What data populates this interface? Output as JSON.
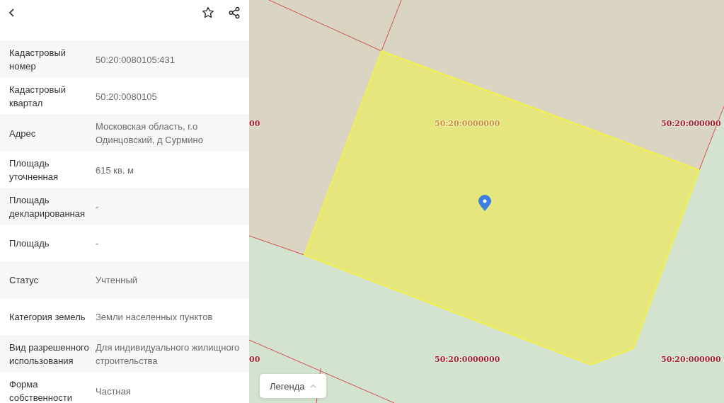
{
  "properties": [
    {
      "label": "Кадастровый номер",
      "value": "50:20:0080105:431"
    },
    {
      "label": "Кадастровый квартал",
      "value": "50:20:0080105"
    },
    {
      "label": "Адрес",
      "value": "Московская область, г.о Одинцовский, д Сурмино"
    },
    {
      "label": "Площадь уточненная",
      "value": "615 кв. м"
    },
    {
      "label": "Площадь декларированная",
      "value": "-"
    },
    {
      "label": "Площадь",
      "value": "-"
    },
    {
      "label": "Статус",
      "value": "Учтенный"
    },
    {
      "label": "Категория земель",
      "value": "Земли населенных пунктов"
    },
    {
      "label": "Вид разрешенного использования",
      "value": "Для индивидуального жилищного строительства"
    },
    {
      "label": "Форма собственности",
      "value": "Частная"
    }
  ],
  "map": {
    "labels": [
      {
        "text": "00",
        "selected": false
      },
      {
        "text": "50:20:0000000",
        "selected": true
      },
      {
        "text": "50:20:000000",
        "selected": false
      },
      {
        "text": "00",
        "selected": false
      },
      {
        "text": "50:20:0000000",
        "selected": false
      },
      {
        "text": "50:20:000000",
        "selected": false
      }
    ],
    "legend_button": "Легенда"
  }
}
